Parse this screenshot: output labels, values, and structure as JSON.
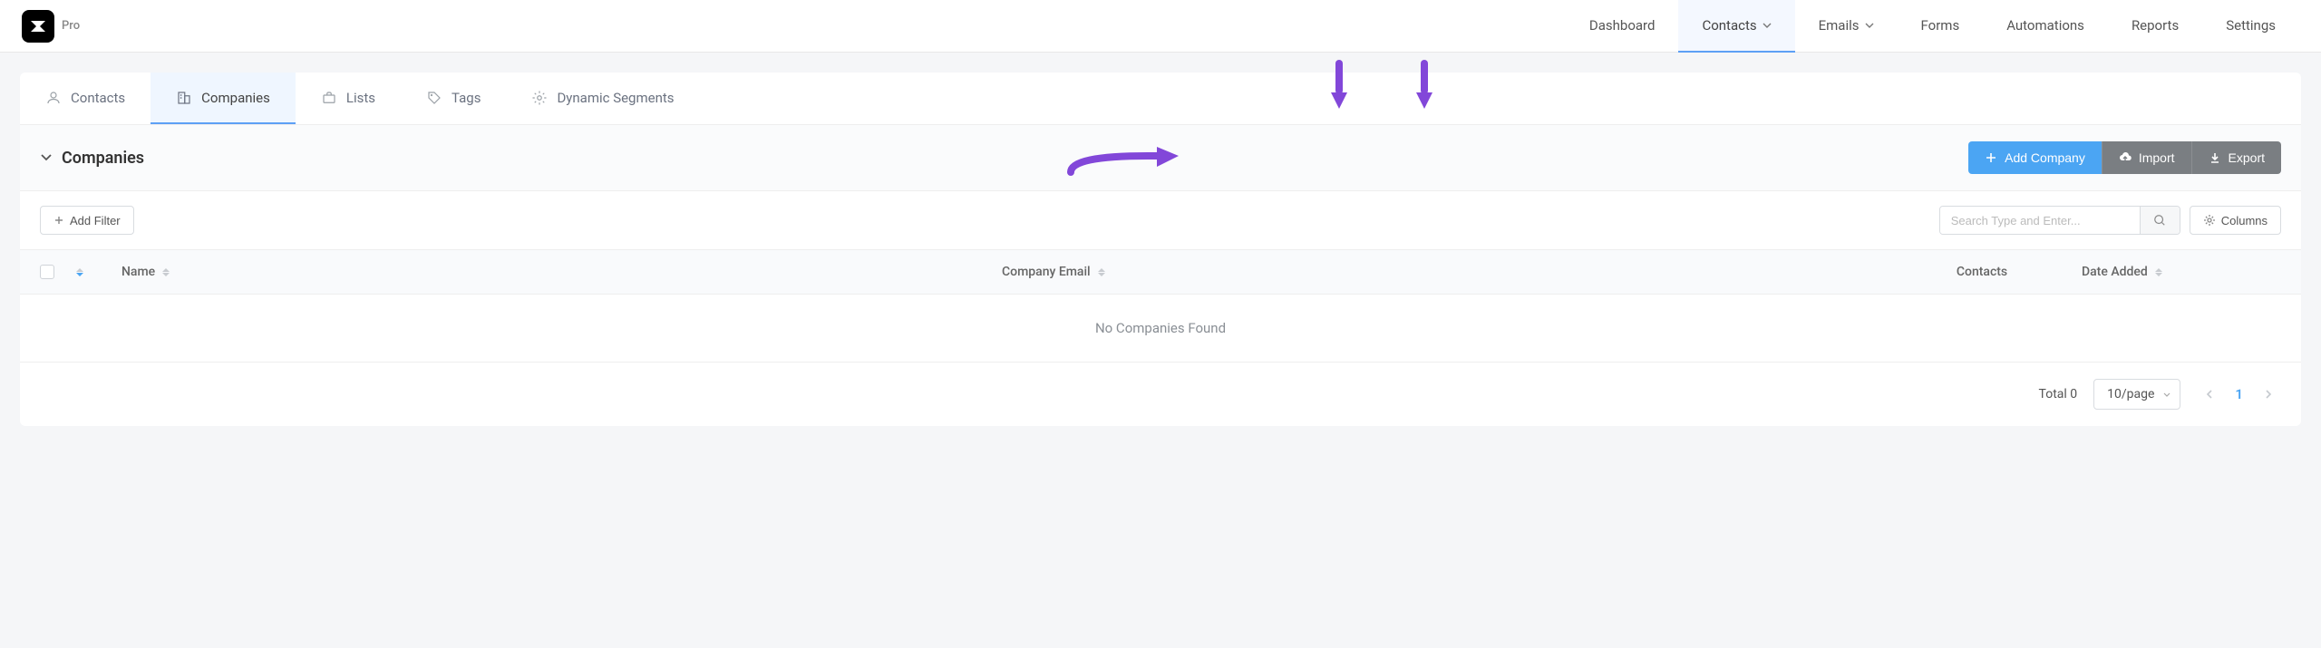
{
  "header": {
    "pro_label": "Pro",
    "nav": {
      "dashboard": "Dashboard",
      "contacts": "Contacts",
      "emails": "Emails",
      "forms": "Forms",
      "automations": "Automations",
      "reports": "Reports",
      "settings": "Settings"
    }
  },
  "subtabs": {
    "contacts": "Contacts",
    "companies": "Companies",
    "lists": "Lists",
    "tags": "Tags",
    "dynamic_segments": "Dynamic Segments"
  },
  "panel": {
    "title": "Companies",
    "actions": {
      "add_company": "Add Company",
      "import": "Import",
      "export": "Export"
    }
  },
  "filter_bar": {
    "add_filter": "Add Filter",
    "search_placeholder": "Search Type and Enter...",
    "columns": "Columns"
  },
  "table": {
    "headers": {
      "name": "Name",
      "company_email": "Company Email",
      "contacts": "Contacts",
      "date_added": "Date Added"
    },
    "empty": "No Companies Found"
  },
  "pagination": {
    "total_label": "Total 0",
    "page_size_label": "10/page",
    "current_page": "1"
  },
  "annotation_color": "#8247d9"
}
